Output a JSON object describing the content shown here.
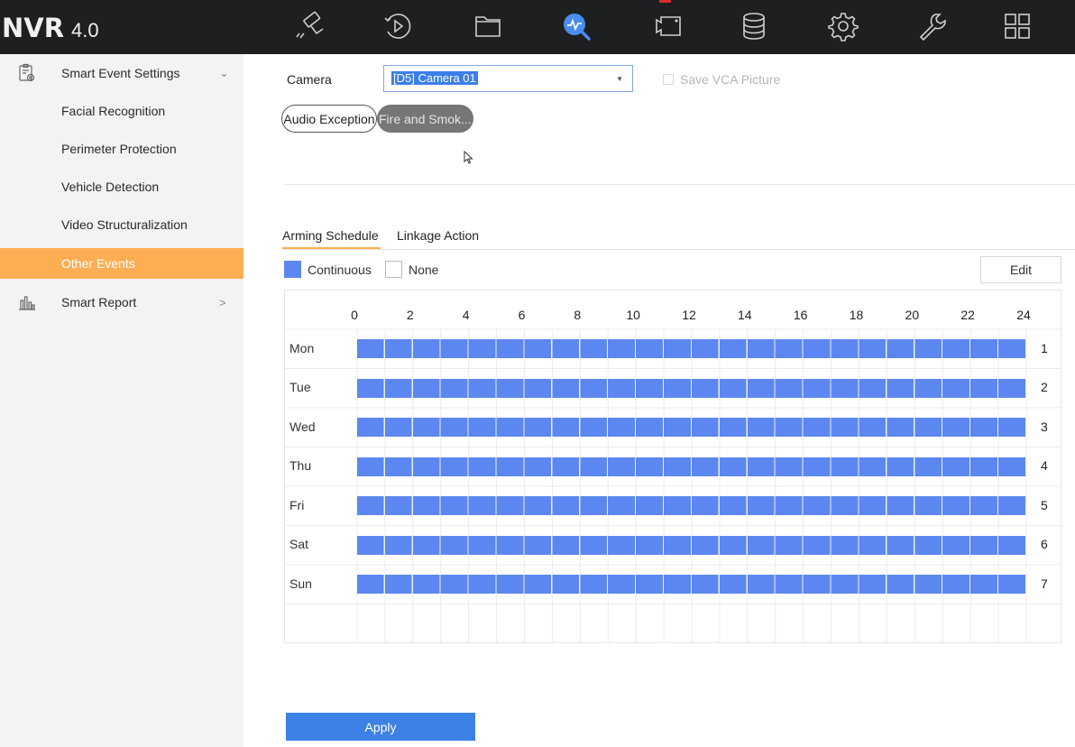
{
  "app": {
    "brand": "NVR",
    "version": "4.0"
  },
  "nav": [
    {
      "name": "live-view-icon"
    },
    {
      "name": "playback-icon"
    },
    {
      "name": "file-management-icon"
    },
    {
      "name": "smart-analysis-icon",
      "active": true
    },
    {
      "name": "configuration-icon"
    },
    {
      "name": "storage-icon"
    },
    {
      "name": "system-settings-icon"
    },
    {
      "name": "maintenance-icon"
    },
    {
      "name": "grid-view-icon"
    }
  ],
  "sidebar": {
    "items": [
      {
        "label": "Smart Event Settings",
        "icon": "event-settings-icon",
        "chevron": "⌄"
      },
      {
        "label": "Facial Recognition"
      },
      {
        "label": "Perimeter Protection"
      },
      {
        "label": "Vehicle Detection"
      },
      {
        "label": "Video Structuralization"
      },
      {
        "label": "Other Events",
        "active": true
      },
      {
        "label": "Smart Report",
        "icon": "report-chart-icon",
        "chevron": ">"
      }
    ]
  },
  "main": {
    "camera_label": "Camera",
    "camera_value": "[D5] Camera 01",
    "save_vca_label": "Save VCA Picture",
    "event_tabs": [
      {
        "label": "Audio Exception"
      },
      {
        "label": "Fire and Smok..."
      }
    ],
    "tabs": [
      {
        "label": "Arming Schedule",
        "active": true
      },
      {
        "label": "Linkage Action"
      }
    ],
    "legend": {
      "continuous": "Continuous",
      "none": "None"
    },
    "edit_label": "Edit",
    "apply_label": "Apply"
  },
  "schedule": {
    "hours": [
      "0",
      "2",
      "4",
      "6",
      "8",
      "10",
      "12",
      "14",
      "16",
      "18",
      "20",
      "22",
      "24"
    ],
    "days": [
      {
        "label": "Mon",
        "num": "1",
        "start": 0,
        "end": 24
      },
      {
        "label": "Tue",
        "num": "2",
        "start": 0,
        "end": 24
      },
      {
        "label": "Wed",
        "num": "3",
        "start": 0,
        "end": 24
      },
      {
        "label": "Thu",
        "num": "4",
        "start": 0,
        "end": 24
      },
      {
        "label": "Fri",
        "num": "5",
        "start": 0,
        "end": 24
      },
      {
        "label": "Sat",
        "num": "6",
        "start": 0,
        "end": 24
      },
      {
        "label": "Sun",
        "num": "7",
        "start": 0,
        "end": 24
      }
    ]
  },
  "colors": {
    "accent": "#fdae53",
    "schedule_bar": "#5d87f0",
    "primary_button": "#3c82e6",
    "active_nav_icon": "#4a8cf0"
  }
}
